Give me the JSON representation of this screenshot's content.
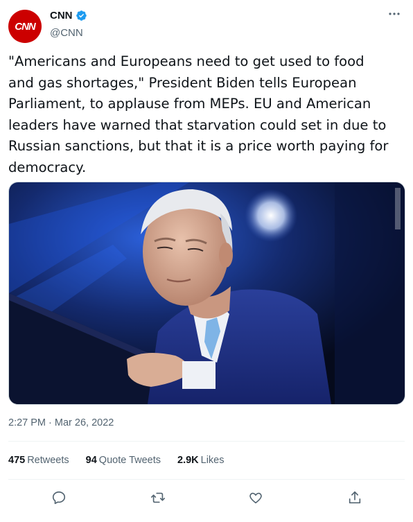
{
  "author": {
    "avatar_text": "CNN",
    "name": "CNN",
    "handle": "@CNN"
  },
  "tweet": {
    "text": "\"Americans and Europeans need to get used to food\nand gas shortages,\" President Biden tells European\nParliament, to applause from MEPs. EU and American\nleaders have warned that starvation could set in due to\nRussian sanctions, but that it is a price worth paying for\ndemocracy.",
    "timestamp": "2:27 PM · Mar 26, 2022"
  },
  "stats": {
    "retweets_count": "475",
    "retweets_label": "Retweets",
    "quotes_count": "94",
    "quotes_label": "Quote Tweets",
    "likes_count": "2.9K",
    "likes_label": "Likes"
  },
  "icons": {
    "more": "more-icon",
    "reply": "reply-icon",
    "retweet": "retweet-icon",
    "like": "like-icon",
    "share": "share-icon"
  },
  "colors": {
    "brand_red": "#cc0000",
    "verified_blue": "#1d9bf0",
    "muted": "#536471"
  }
}
